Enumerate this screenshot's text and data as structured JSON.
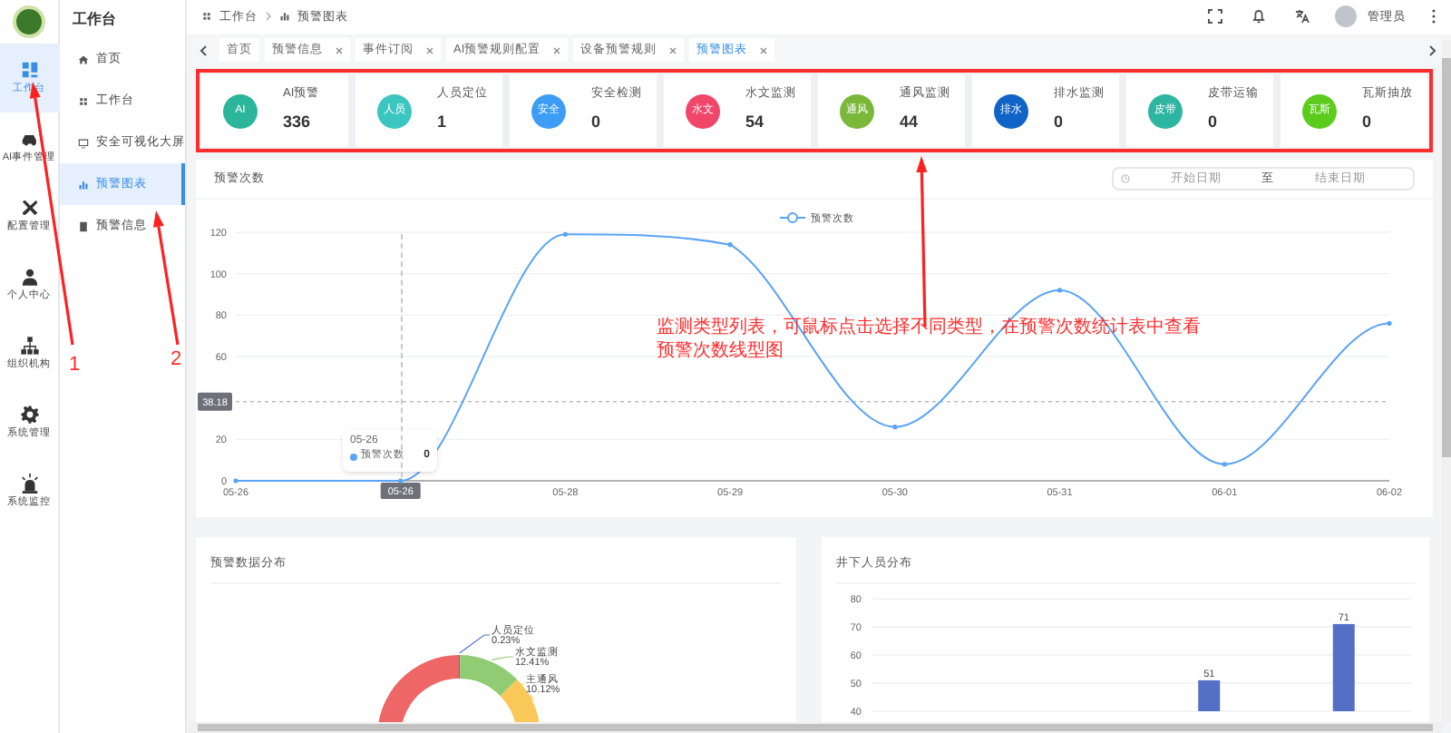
{
  "rail": {
    "items": [
      {
        "label": "工作台",
        "selected": true
      },
      {
        "label": "AI事件管理",
        "selected": false
      },
      {
        "label": "配置管理",
        "selected": false
      },
      {
        "label": "个人中心",
        "selected": false
      },
      {
        "label": "组织机构",
        "selected": false
      },
      {
        "label": "系统管理",
        "selected": false
      },
      {
        "label": "系统监控",
        "selected": false
      }
    ]
  },
  "sidebar": {
    "title": "工作台",
    "items": [
      {
        "label": "首页",
        "selected": false
      },
      {
        "label": "工作台",
        "selected": false
      },
      {
        "label": "安全可视化大屏",
        "selected": false
      },
      {
        "label": "预警图表",
        "selected": true
      },
      {
        "label": "预警信息",
        "selected": false
      }
    ]
  },
  "breadcrumb": [
    "工作台",
    "预警图表"
  ],
  "header": {
    "user": "管理员"
  },
  "tabs": [
    {
      "label": "首页",
      "closable": false,
      "selected": false
    },
    {
      "label": "预警信息",
      "closable": true,
      "selected": false
    },
    {
      "label": "事件订阅",
      "closable": true,
      "selected": false
    },
    {
      "label": "AI预警规则配置",
      "closable": true,
      "selected": false
    },
    {
      "label": "设备预警规则",
      "closable": true,
      "selected": false
    },
    {
      "label": "预警图表",
      "closable": true,
      "selected": true
    }
  ],
  "types": [
    {
      "badge": "AI",
      "label": "AI预警",
      "count": "336",
      "color": "#2bb59a"
    },
    {
      "badge": "人员",
      "label": "人员定位",
      "count": "1",
      "color": "#3cc6c0"
    },
    {
      "badge": "安全",
      "label": "安全检测",
      "count": "0",
      "color": "#3d9df5"
    },
    {
      "badge": "水文",
      "label": "水文监测",
      "count": "54",
      "color": "#f0466a"
    },
    {
      "badge": "通风",
      "label": "通风监测",
      "count": "44",
      "color": "#7ab83a"
    },
    {
      "badge": "排水",
      "label": "排水监测",
      "count": "0",
      "color": "#1064c8"
    },
    {
      "badge": "皮带",
      "label": "皮带运输",
      "count": "0",
      "color": "#2cb5a0"
    },
    {
      "badge": "瓦斯",
      "label": "瓦斯抽放",
      "count": "0",
      "color": "#5ccc1c"
    }
  ],
  "line_panel": {
    "title": "预警次数",
    "date_range": {
      "start_placeholder": "开始日期",
      "separator": "至",
      "end_placeholder": "结束日期"
    },
    "chart_data": {
      "type": "line",
      "categories": [
        "05-26",
        "05-26",
        "05-28",
        "05-29",
        "05-30",
        "05-31",
        "06-01",
        "06-02"
      ],
      "series": [
        {
          "name": "预警次数",
          "color": "#5aa3f5",
          "values": [
            0,
            0,
            119,
            114,
            26,
            92,
            8,
            76
          ]
        }
      ],
      "ylim": [
        0,
        120
      ],
      "yticks": [
        0,
        20,
        60,
        80,
        100,
        120
      ],
      "grid": true,
      "ref_lines": [
        {
          "axis": "y",
          "value": 38.18,
          "label": "38.18"
        }
      ]
    },
    "tooltip": {
      "title": "05-26",
      "series": "预警次数",
      "value": "0"
    }
  },
  "pie_panel": {
    "title": "预警数据分布",
    "chart_data": {
      "type": "donut",
      "categories": [
        "人员定位",
        "水文监测",
        "主通风",
        null
      ],
      "series": [
        {
          "values": [
            0.23,
            12.41,
            10.12,
            77.24
          ]
        }
      ],
      "value_labels": [
        "0.23%",
        "12.41%",
        "10.12%",
        null
      ]
    }
  },
  "bar_panel": {
    "title": "井下人员分布",
    "chart_data": {
      "type": "bar",
      "series": [
        {
          "color": "#5470c6",
          "values": [
            null,
            null,
            51,
            71
          ]
        }
      ],
      "ylim": [
        40,
        80
      ],
      "yticks": [
        40,
        50,
        60,
        70,
        80
      ],
      "grid": true,
      "data_labels": true
    }
  },
  "annotations": {
    "note": "监测类型列表，可鼠标点击选择不同类型，在预警次数统计表中查看预警次数线型图",
    "markers": [
      "1",
      "2"
    ]
  }
}
